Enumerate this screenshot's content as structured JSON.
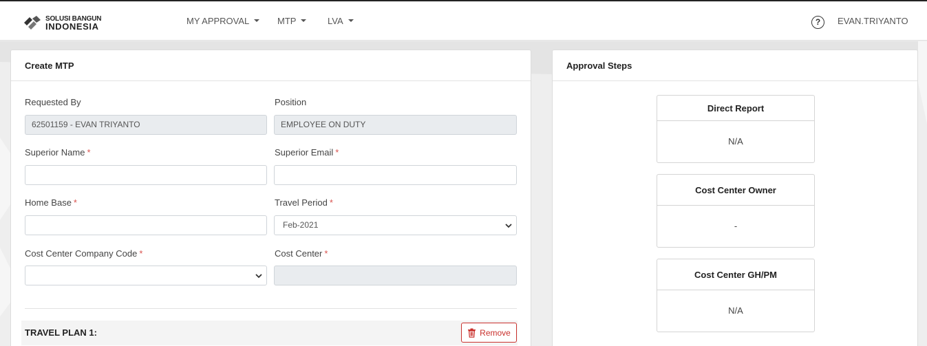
{
  "brand": {
    "line1": "SOLUSI BANGUN",
    "line2": "INDONESIA"
  },
  "nav": {
    "items": [
      {
        "label": "MY APPROVAL"
      },
      {
        "label": "MTP"
      },
      {
        "label": "LVA"
      }
    ],
    "help_glyph": "?",
    "user": "EVAN.TRIYANTO"
  },
  "form": {
    "title": "Create MTP",
    "requested_by": {
      "label": "Requested By",
      "value": "62501159 - EVAN TRIYANTO"
    },
    "position": {
      "label": "Position",
      "value": "EMPLOYEE ON DUTY"
    },
    "superior_name": {
      "label": "Superior Name",
      "value": "",
      "required": "*"
    },
    "superior_email": {
      "label": "Superior Email",
      "value": "",
      "required": "*"
    },
    "home_base": {
      "label": "Home Base",
      "value": "",
      "required": "*"
    },
    "travel_period": {
      "label": "Travel Period",
      "value": "Feb-2021",
      "required": "*"
    },
    "cost_center_company_code": {
      "label": "Cost Center Company Code",
      "value": "",
      "required": "*"
    },
    "cost_center": {
      "label": "Cost Center",
      "value": "",
      "required": "*"
    },
    "travel_plan": {
      "title": "TRAVEL PLAN 1:",
      "remove_label": "Remove"
    }
  },
  "approval": {
    "title": "Approval Steps",
    "steps": [
      {
        "title": "Direct Report",
        "value": "N/A"
      },
      {
        "title": "Cost Center Owner",
        "value": "-"
      },
      {
        "title": "Cost Center GH/PM",
        "value": "N/A"
      }
    ]
  },
  "colors": {
    "required": "#d9534f",
    "danger": "#c9302c",
    "readonly_bg": "#e9ecef"
  }
}
